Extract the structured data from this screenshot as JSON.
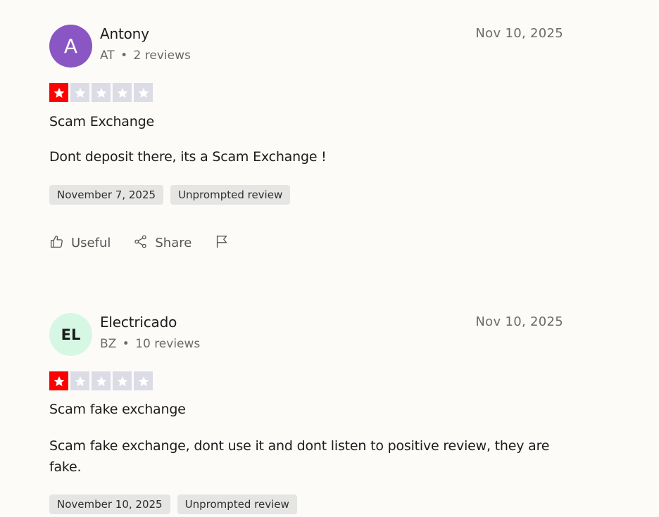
{
  "reviews": [
    {
      "avatar_letter": "A",
      "avatar_bg": "#8a56c4",
      "avatar_fg": "#ffffff",
      "name": "Antony",
      "country": "AT",
      "separator": "•",
      "review_count": "2 reviews",
      "date": "Nov 10, 2025",
      "rating": 1,
      "title": "Scam Exchange",
      "body": "Dont deposit there, its a Scam Exchange !",
      "tags": [
        "November 7, 2025",
        "Unprompted review"
      ],
      "actions": {
        "useful": "Useful",
        "share": "Share"
      }
    },
    {
      "avatar_letter": "EL",
      "avatar_bg": "#d6f7e3",
      "avatar_fg": "#1c1c1c",
      "name": "Electricado",
      "country": "BZ",
      "separator": "•",
      "review_count": "10 reviews",
      "date": "Nov 10, 2025",
      "rating": 1,
      "title": "Scam fake exchange",
      "body": "Scam fake exchange, dont use it and dont listen to positive review, they are fake.",
      "tags": [
        "November 10, 2025",
        "Unprompted review"
      ]
    }
  ],
  "colors": {
    "star_filled": "#ff0000",
    "star_empty": "#dcdce6"
  },
  "icons": {
    "useful": "thumbs-up-icon",
    "share": "share-icon",
    "report": "flag-icon",
    "star": "star-icon"
  }
}
